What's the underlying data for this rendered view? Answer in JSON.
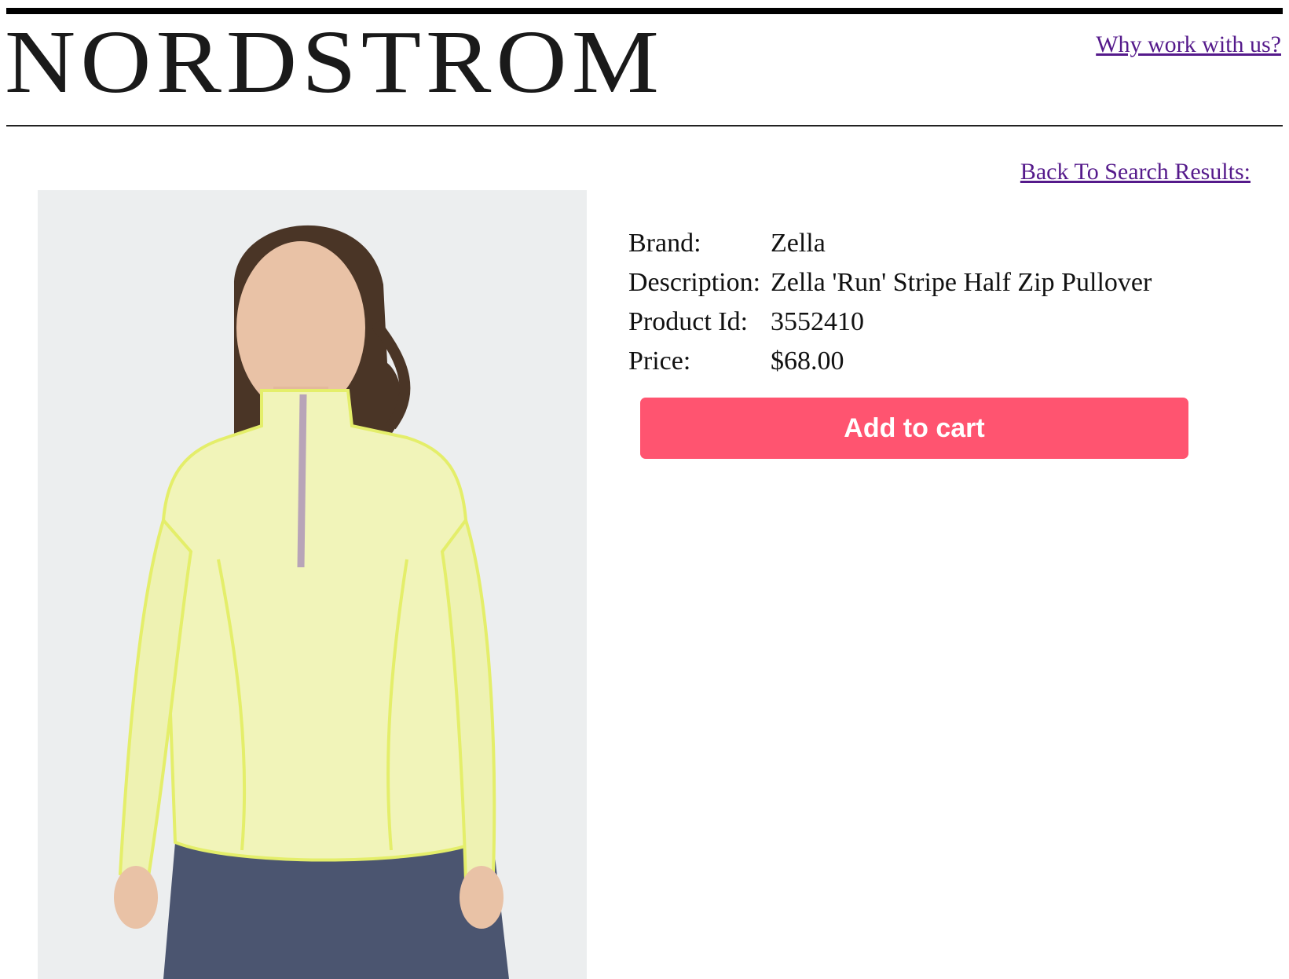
{
  "header": {
    "logo_text": "NORDSTROM",
    "why_link": "Why work with us?"
  },
  "nav": {
    "back_link": "Back To Search Results:"
  },
  "product": {
    "image_icon": "model-wearing-pullover-image",
    "rows": [
      {
        "label": "Brand:",
        "value": "Zella"
      },
      {
        "label": "Description:",
        "value": "Zella 'Run' Stripe Half Zip Pullover"
      },
      {
        "label": "Product Id:",
        "value": "3552410"
      },
      {
        "label": "Price:",
        "value": "$68.00"
      }
    ],
    "add_to_cart_label": "Add to cart"
  },
  "colors": {
    "button": "#ff5470",
    "link": "#551a8b",
    "rule": "#000000"
  }
}
